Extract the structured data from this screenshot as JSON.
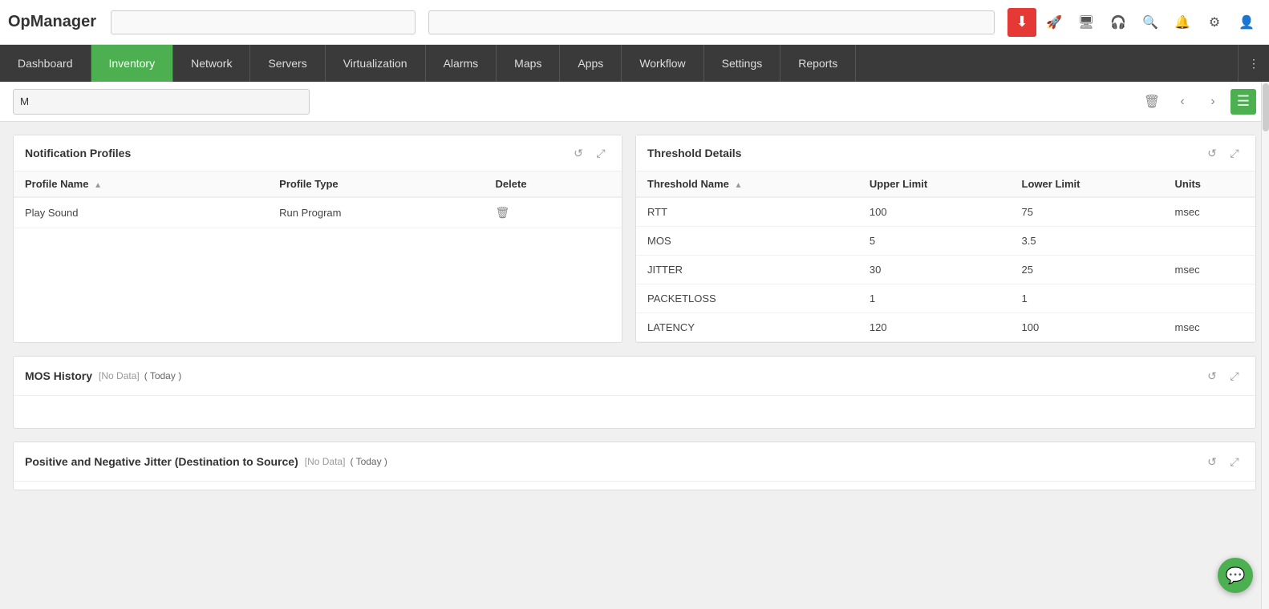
{
  "app": {
    "logo": "OpManager"
  },
  "topbar": {
    "search_left_placeholder": "",
    "search_right_placeholder": ""
  },
  "nav": {
    "items": [
      {
        "id": "dashboard",
        "label": "Dashboard",
        "active": false
      },
      {
        "id": "inventory",
        "label": "Inventory",
        "active": true
      },
      {
        "id": "network",
        "label": "Network",
        "active": false
      },
      {
        "id": "servers",
        "label": "Servers",
        "active": false
      },
      {
        "id": "virtualization",
        "label": "Virtualization",
        "active": false
      },
      {
        "id": "alarms",
        "label": "Alarms",
        "active": false
      },
      {
        "id": "maps",
        "label": "Maps",
        "active": false
      },
      {
        "id": "apps",
        "label": "Apps",
        "active": false
      },
      {
        "id": "workflow",
        "label": "Workflow",
        "active": false
      },
      {
        "id": "settings",
        "label": "Settings",
        "active": false
      },
      {
        "id": "reports",
        "label": "Reports",
        "active": false
      }
    ]
  },
  "page_header": {
    "title_placeholder": "M",
    "delete_label": "🗑",
    "prev_label": "‹",
    "next_label": "›",
    "menu_label": "☰"
  },
  "notification_profiles": {
    "title": "Notification Profiles",
    "columns": [
      {
        "key": "name",
        "label": "Profile Name"
      },
      {
        "key": "type",
        "label": "Profile Type"
      },
      {
        "key": "delete",
        "label": "Delete"
      }
    ],
    "rows": [
      {
        "name": "Play Sound",
        "type": "Run Program",
        "delete": "🗑"
      }
    ]
  },
  "threshold_details": {
    "title": "Threshold Details",
    "columns": [
      {
        "key": "name",
        "label": "Threshold Name"
      },
      {
        "key": "upper",
        "label": "Upper Limit"
      },
      {
        "key": "lower",
        "label": "Lower Limit"
      },
      {
        "key": "units",
        "label": "Units"
      }
    ],
    "rows": [
      {
        "name": "RTT",
        "upper": "100",
        "lower": "75",
        "units": "msec"
      },
      {
        "name": "MOS",
        "upper": "5",
        "lower": "3.5",
        "units": ""
      },
      {
        "name": "JITTER",
        "upper": "30",
        "lower": "25",
        "units": "msec"
      },
      {
        "name": "PACKETLOSS",
        "upper": "1",
        "lower": "1",
        "units": ""
      },
      {
        "name": "LATENCY",
        "upper": "120",
        "lower": "100",
        "units": "msec"
      }
    ]
  },
  "mos_history": {
    "title": "MOS History",
    "no_data_label": "[No Data]",
    "date_range": "( Today )"
  },
  "jitter_section": {
    "title": "Positive and Negative Jitter (Destination to Source)",
    "no_data_label": "[No Data]",
    "date_range": "( Today )"
  },
  "icons": {
    "download": "⬇",
    "rocket": "🚀",
    "monitor": "🖥",
    "headset": "🎧",
    "search": "🔍",
    "bell": "🔔",
    "gear": "⚙",
    "user": "👤",
    "refresh": "↺",
    "expand": "⤢",
    "more": "⋮"
  }
}
